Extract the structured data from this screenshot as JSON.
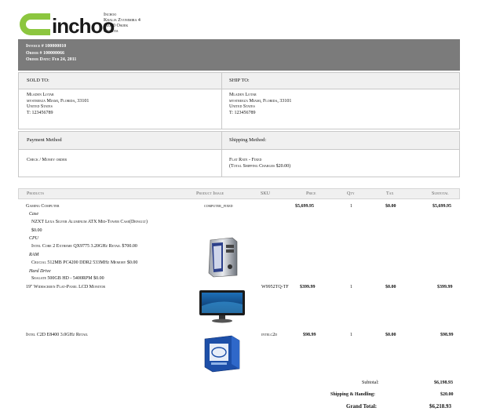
{
  "store": {
    "logo_text": "inchoo",
    "address_lines": [
      "Inchoo",
      "Kralja Zvonimira 4",
      "31000 Osijek",
      "Croatia"
    ]
  },
  "invoice": {
    "invoice_line": "Invoice # 100000010",
    "order_line": "Order # 100000066",
    "date_line": "Order Date: Feb 24, 2011"
  },
  "addresses": {
    "sold_to_label": "SOLD TO:",
    "ship_to_label": "SHIP TO:",
    "sold_to": [
      "Mladen Lotar",
      "mystreeza Miami, Florida, 33101",
      "United States",
      "T: 123456789"
    ],
    "ship_to": [
      "Mladen Lotar",
      "mystreeza Miami, Florida, 33101",
      "United States",
      "T: 123456789"
    ]
  },
  "methods": {
    "payment_label": "Payment Method",
    "shipping_label": "Shipping Method:",
    "payment_value": "Check / Money order",
    "shipping_value_1": "Flat Rate - Fixed",
    "shipping_value_2": "(Total Shipping Charges $20.00)"
  },
  "products": {
    "headers": [
      "Products",
      "Product Image",
      "SKU",
      "Price",
      "Qty",
      "Tax",
      "Subtotal"
    ],
    "items": [
      {
        "name": "Gaming Computer",
        "image_label": "computer_fixed",
        "sku": "",
        "price": "$5,699.95",
        "qty": "1",
        "tax": "$0.00",
        "subtotal": "$5,699.95",
        "options": [
          {
            "label": "Case",
            "value": "NZXT Lexa Silver Aluminum ATX Mid-Tower Case(Default)",
            "extra": "$0.00"
          },
          {
            "label": "CPU",
            "value": "Intel Core 2 Extreme QX9775 3.20GHz Retail $700.00",
            "extra": ""
          },
          {
            "label": "RAM",
            "value": "Crucial 512MB PC4200 DDR2 533MHz Memory $0.00",
            "extra": ""
          },
          {
            "label": "Hard Drive",
            "value": "Seagate 500GB HD - 5400RPM $0.00",
            "extra": ""
          }
        ]
      },
      {
        "name": "19\" Widescreen Flat-Panel LCD Monitor",
        "image_label": "",
        "sku": "W9952TQ-TF",
        "price": "$399.99",
        "qty": "1",
        "tax": "$0.00",
        "subtotal": "$399.99"
      },
      {
        "name": "Intel C2D E8400 3.0GHz Retail",
        "image_label": "",
        "sku": "intelc2d",
        "price": "$98.99",
        "qty": "1",
        "tax": "$0.00",
        "subtotal": "$98.99"
      }
    ]
  },
  "totals": {
    "subtotal_label": "Subtotal:",
    "subtotal_value": "$6,198.93",
    "shipping_label": "Shipping & Handling:",
    "shipping_value": "$20.00",
    "grand_label": "Grand Total:",
    "grand_value": "$6,218.93"
  },
  "colors": {
    "brand_green": "#8cc63f",
    "invoice_bar": "#7b7b7b"
  }
}
